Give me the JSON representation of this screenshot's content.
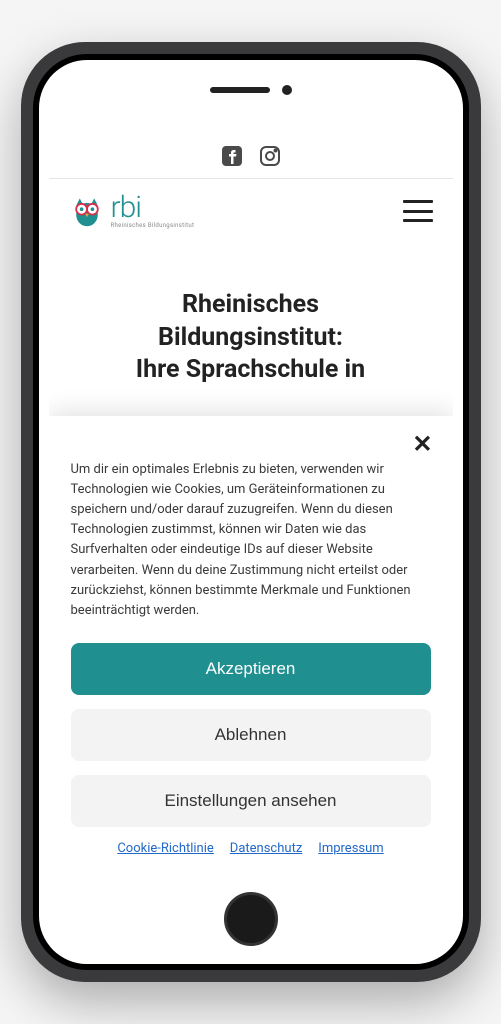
{
  "logo": {
    "main": "rbi",
    "sub": "Rheinisches Bildungsinstitut"
  },
  "hero": {
    "title_line1": "Rheinisches",
    "title_line2": "Bildungsinstitut:",
    "title_line3": "Ihre Sprachschule in"
  },
  "consent": {
    "text": "Um dir ein optimales Erlebnis zu bieten, verwenden wir Technologien wie Cookies, um Geräteinformationen zu speichern und/oder darauf zuzugreifen. Wenn du diesen Technologien zustimmst, können wir Daten wie das Surfverhalten oder eindeutige IDs auf dieser Website verarbeiten. Wenn du deine Zustimmung nicht erteilst oder zurückziehst, können bestimmte Merkmale und Funktionen beeinträchtigt werden.",
    "accept": "Akzeptieren",
    "decline": "Ablehnen",
    "settings": "Einstellungen ansehen",
    "links": {
      "cookie": "Cookie-Richtlinie",
      "privacy": "Datenschutz",
      "imprint": "Impressum"
    }
  }
}
